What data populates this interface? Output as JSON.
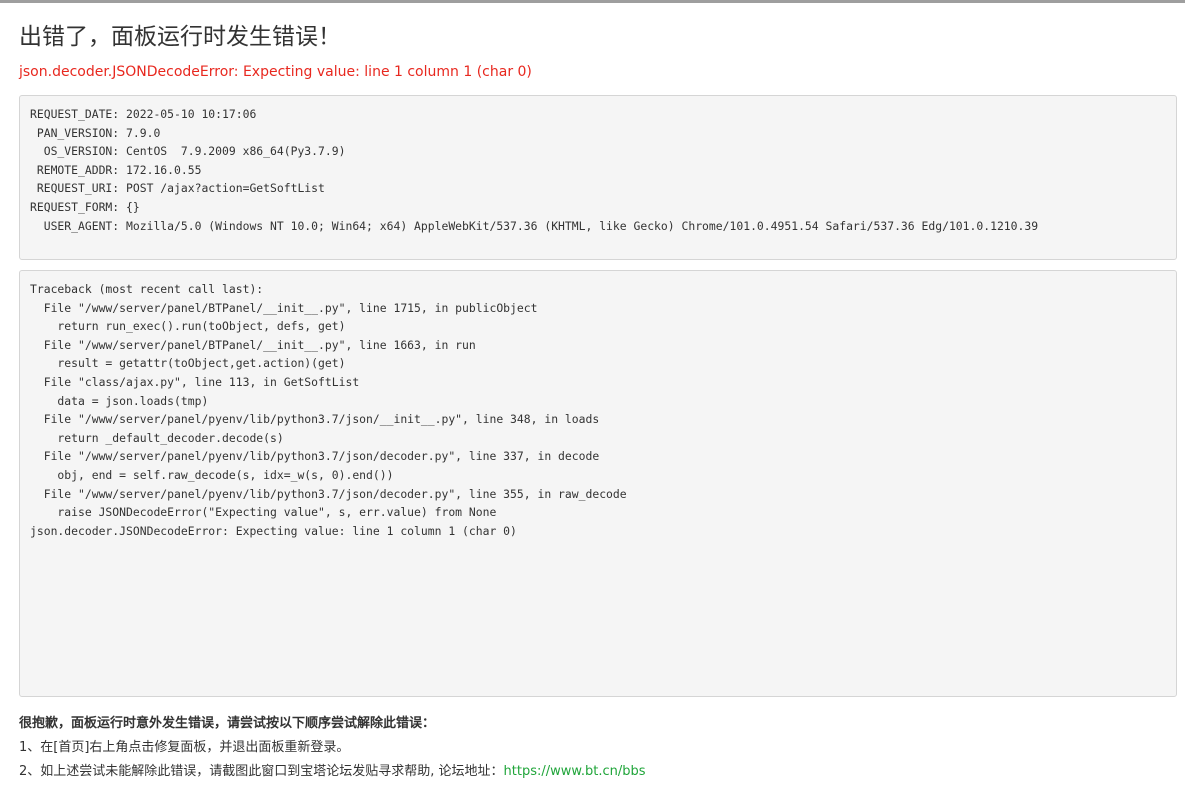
{
  "page": {
    "title": "出错了，面板运行时发生错误！",
    "error_message": "json.decoder.JSONDecodeError: Expecting value: line 1 column 1 (char 0)"
  },
  "request_info": {
    "lines": [
      "REQUEST_DATE: 2022-05-10 10:17:06",
      " PAN_VERSION: 7.9.0",
      "  OS_VERSION: CentOS  7.9.2009 x86_64(Py3.7.9)",
      " REMOTE_ADDR: 172.16.0.55",
      " REQUEST_URI: POST /ajax?action=GetSoftList",
      "REQUEST_FORM: {}",
      "  USER_AGENT: Mozilla/5.0 (Windows NT 10.0; Win64; x64) AppleWebKit/537.36 (KHTML, like Gecko) Chrome/101.0.4951.54 Safari/537.36 Edg/101.0.1210.39"
    ]
  },
  "traceback": {
    "lines": [
      "Traceback (most recent call last):",
      "  File \"/www/server/panel/BTPanel/__init__.py\", line 1715, in publicObject",
      "    return run_exec().run(toObject, defs, get)",
      "  File \"/www/server/panel/BTPanel/__init__.py\", line 1663, in run",
      "    result = getattr(toObject,get.action)(get)",
      "  File \"class/ajax.py\", line 113, in GetSoftList",
      "    data = json.loads(tmp)",
      "  File \"/www/server/panel/pyenv/lib/python3.7/json/__init__.py\", line 348, in loads",
      "    return _default_decoder.decode(s)",
      "  File \"/www/server/panel/pyenv/lib/python3.7/json/decoder.py\", line 337, in decode",
      "    obj, end = self.raw_decode(s, idx=_w(s, 0).end())",
      "  File \"/www/server/panel/pyenv/lib/python3.7/json/decoder.py\", line 355, in raw_decode",
      "    raise JSONDecodeError(\"Expecting value\", s, err.value) from None",
      "json.decoder.JSONDecodeError: Expecting value: line 1 column 1 (char 0)"
    ]
  },
  "help": {
    "heading": "很抱歉，面板运行时意外发生错误，请尝试按以下顺序尝试解除此错误：",
    "item1": "1、在[首页]右上角点击修复面板，并退出面板重新登录。",
    "item2_prefix": "2、如上述尝试未能解除此错误，请截图此窗口到宝塔论坛发贴寻求帮助, 论坛地址：",
    "forum_link": "https://www.bt.cn/bbs"
  },
  "colors": {
    "error_red": "#e8281f",
    "link_green": "#20a53a",
    "box_background": "#f5f5f5"
  }
}
